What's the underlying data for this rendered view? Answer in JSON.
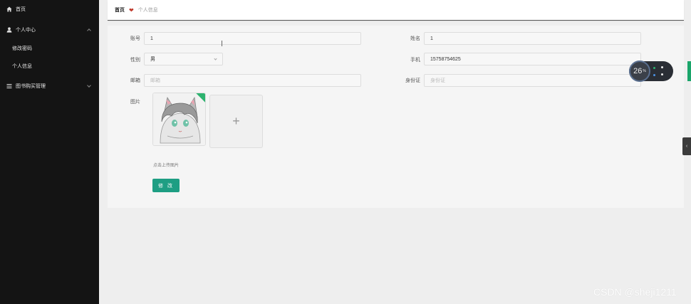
{
  "sidebar": {
    "home": "首页",
    "personal_center": "个人中心",
    "sub_items": [
      "修改密码",
      "个人信息"
    ],
    "book_purchase_mgmt": "图书购买管理"
  },
  "breadcrumb": {
    "home": "首页",
    "current": "个人信息"
  },
  "form": {
    "account": {
      "label": "账号",
      "value": "1"
    },
    "name": {
      "label": "姓名",
      "value": "1"
    },
    "gender": {
      "label": "性别",
      "value": "男"
    },
    "phone": {
      "label": "手机",
      "value": "15758754625"
    },
    "email": {
      "label": "邮箱",
      "placeholder": "邮箱"
    },
    "id_card": {
      "label": "身份证",
      "placeholder": "身份证"
    },
    "image": {
      "label": "图片"
    },
    "upload_hint": "点击上传图片",
    "submit": "修 改"
  },
  "widget": {
    "value": "26",
    "unit": "%"
  },
  "watermark": "CSDN @sheji1211",
  "colors": {
    "sidebar_bg": "#141414",
    "accent": "#1e9e83",
    "heart": "#c0392b"
  }
}
